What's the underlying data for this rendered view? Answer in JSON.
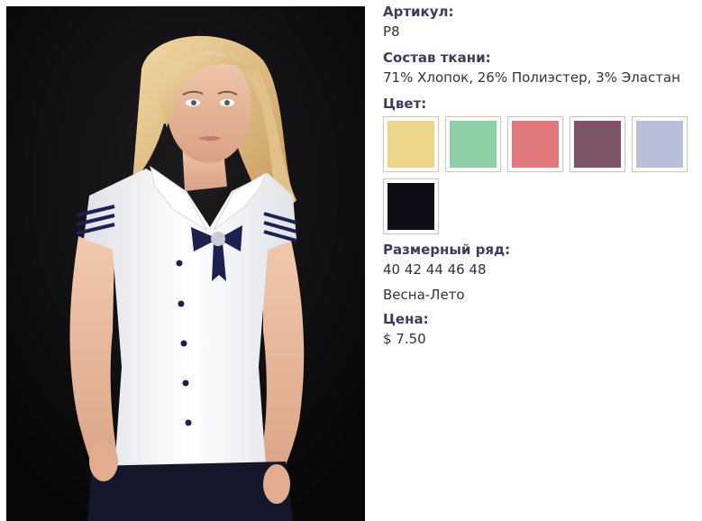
{
  "product": {
    "article_label": "Артикул:",
    "article_value": "P8",
    "fabric_label": "Состав ткани:",
    "fabric_value": "71% Хлопок, 26% Полиэстер, 3% Эластан",
    "color_label": "Цвет:",
    "colors": [
      {
        "name": "yellow",
        "hex": "#ecd589"
      },
      {
        "name": "mint-green",
        "hex": "#8fcfa6"
      },
      {
        "name": "coral-pink",
        "hex": "#e0787c"
      },
      {
        "name": "plum",
        "hex": "#7f5468"
      },
      {
        "name": "lavender-grey",
        "hex": "#b8bfd8"
      },
      {
        "name": "black",
        "hex": "#0d0e16"
      }
    ],
    "sizes_label": "Размерный ряд:",
    "sizes_value": "40 42 44 46 48",
    "season": "Весна-Лето",
    "price_label": "Цена:",
    "price_value": "$ 7.50"
  },
  "photo": {
    "background_hex": "#0b0b0d",
    "shirt_hex": "#f4f5f7",
    "trim_hex": "#1c2150"
  }
}
